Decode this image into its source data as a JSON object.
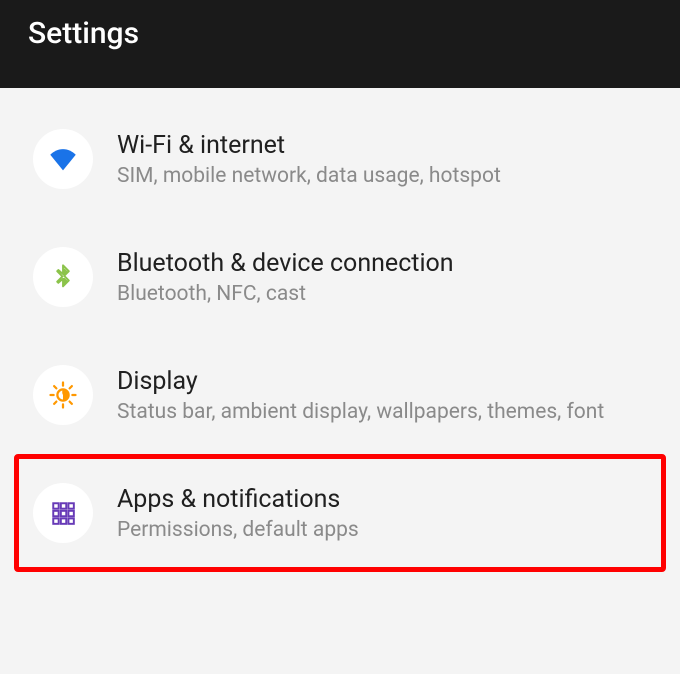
{
  "header": {
    "title": "Settings"
  },
  "items": [
    {
      "name": "settings-item-wifi",
      "icon": "wifi-icon",
      "title": "Wi-Fi & internet",
      "subtitle": "SIM, mobile network, data usage, hotspot",
      "highlight": false
    },
    {
      "name": "settings-item-bluetooth",
      "icon": "bluetooth-icon",
      "title": "Bluetooth & device connection",
      "subtitle": "Bluetooth, NFC, cast",
      "highlight": false
    },
    {
      "name": "settings-item-display",
      "icon": "display-icon",
      "title": "Display",
      "subtitle": "Status bar, ambient display, wallpapers, themes, font",
      "highlight": false
    },
    {
      "name": "settings-item-apps",
      "icon": "apps-icon",
      "title": "Apps & notifications",
      "subtitle": "Permissions, default apps",
      "highlight": true
    }
  ],
  "colors": {
    "wifi": "#1a73e8",
    "bluetooth": "#8bc34a",
    "display": "#ff9800",
    "apps": "#673ab7",
    "highlight": "#ff0000"
  }
}
